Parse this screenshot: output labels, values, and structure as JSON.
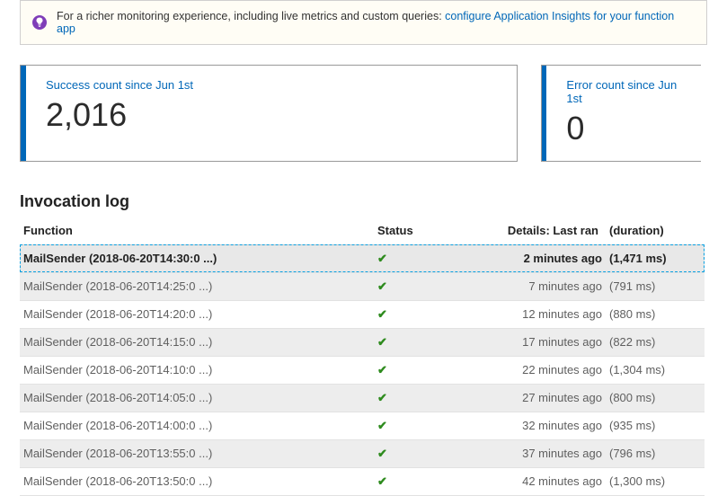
{
  "banner": {
    "text": "For a richer monitoring experience, including live metrics and custom queries: ",
    "link": "configure Application Insights for your function app"
  },
  "cards": {
    "success": {
      "label": "Success count since Jun 1st",
      "value": "2,016"
    },
    "error": {
      "label": "Error count since Jun 1st",
      "value": "0"
    }
  },
  "log": {
    "title": "Invocation log",
    "headers": {
      "function": "Function",
      "status": "Status",
      "lastRan": "Details: Last ran",
      "duration": "(duration)"
    },
    "rows": [
      {
        "function": "MailSender (2018-06-20T14:30:0 ...)",
        "status": "ok",
        "lastRan": "2 minutes ago",
        "duration": "(1,471 ms)",
        "selected": true
      },
      {
        "function": "MailSender (2018-06-20T14:25:0 ...)",
        "status": "ok",
        "lastRan": "7 minutes ago",
        "duration": "(791 ms)"
      },
      {
        "function": "MailSender (2018-06-20T14:20:0 ...)",
        "status": "ok",
        "lastRan": "12 minutes ago",
        "duration": "(880 ms)"
      },
      {
        "function": "MailSender (2018-06-20T14:15:0 ...)",
        "status": "ok",
        "lastRan": "17 minutes ago",
        "duration": "(822 ms)"
      },
      {
        "function": "MailSender (2018-06-20T14:10:0 ...)",
        "status": "ok",
        "lastRan": "22 minutes ago",
        "duration": "(1,304 ms)"
      },
      {
        "function": "MailSender (2018-06-20T14:05:0 ...)",
        "status": "ok",
        "lastRan": "27 minutes ago",
        "duration": "(800 ms)"
      },
      {
        "function": "MailSender (2018-06-20T14:00:0 ...)",
        "status": "ok",
        "lastRan": "32 minutes ago",
        "duration": "(935 ms)"
      },
      {
        "function": "MailSender (2018-06-20T13:55:0 ...)",
        "status": "ok",
        "lastRan": "37 minutes ago",
        "duration": "(796 ms)"
      },
      {
        "function": "MailSender (2018-06-20T13:50:0 ...)",
        "status": "ok",
        "lastRan": "42 minutes ago",
        "duration": "(1,300 ms)"
      }
    ]
  }
}
